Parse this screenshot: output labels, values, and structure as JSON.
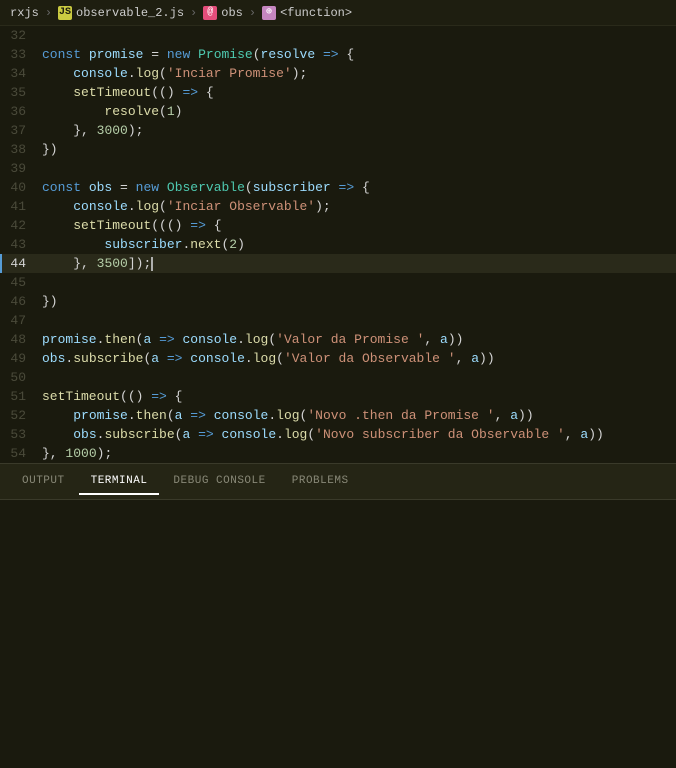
{
  "breadcrumb": {
    "items": [
      {
        "label": "rxjs",
        "type": "text"
      },
      {
        "label": "observable_2.js",
        "type": "js-file"
      },
      {
        "label": "obs",
        "type": "obs"
      },
      {
        "label": "<function>",
        "type": "fn"
      }
    ]
  },
  "tabs": {
    "panel_tabs": [
      "OUTPUT",
      "TERMINAL",
      "DEBUG CONSOLE",
      "PROBLEMS"
    ],
    "active_tab": "TERMINAL"
  },
  "code": {
    "lines": [
      {
        "num": 32,
        "content": "",
        "active": false
      },
      {
        "num": 33,
        "content": "const promise = new Promise(resolve => {",
        "active": false
      },
      {
        "num": 34,
        "content": "    console.log('Inciar Promise');",
        "active": false
      },
      {
        "num": 35,
        "content": "    setTimeout(() => {",
        "active": false
      },
      {
        "num": 36,
        "content": "        resolve(1)",
        "active": false
      },
      {
        "num": 37,
        "content": "    }, 3000);",
        "active": false
      },
      {
        "num": 38,
        "content": "})",
        "active": false
      },
      {
        "num": 39,
        "content": "",
        "active": false
      },
      {
        "num": 40,
        "content": "const obs = new Observable(subscriber => {",
        "active": false
      },
      {
        "num": 41,
        "content": "    console.log('Inciar Observable');",
        "active": false
      },
      {
        "num": 42,
        "content": "    setTimeout((() => {",
        "active": false
      },
      {
        "num": 43,
        "content": "        subscriber.next(2)",
        "active": false
      },
      {
        "num": 44,
        "content": "    }, 3500);",
        "active": true
      },
      {
        "num": 45,
        "content": "",
        "active": false
      },
      {
        "num": 46,
        "content": "})",
        "active": false
      },
      {
        "num": 47,
        "content": "",
        "active": false
      },
      {
        "num": 48,
        "content": "promise.then(a => console.log('Valor da Promise ', a))",
        "active": false
      },
      {
        "num": 49,
        "content": "obs.subscribe(a => console.log('Valor da Observable ', a))",
        "active": false
      },
      {
        "num": 50,
        "content": "",
        "active": false
      },
      {
        "num": 51,
        "content": "setTimeout(() => {",
        "active": false
      },
      {
        "num": 52,
        "content": "    promise.then(a => console.log('Novo .then da Promise ', a))",
        "active": false
      },
      {
        "num": 53,
        "content": "    obs.subscribe(a => console.log('Novo subscriber da Observable ', a))",
        "active": false
      },
      {
        "num": 54,
        "content": "}, 1000);",
        "active": false
      }
    ]
  }
}
